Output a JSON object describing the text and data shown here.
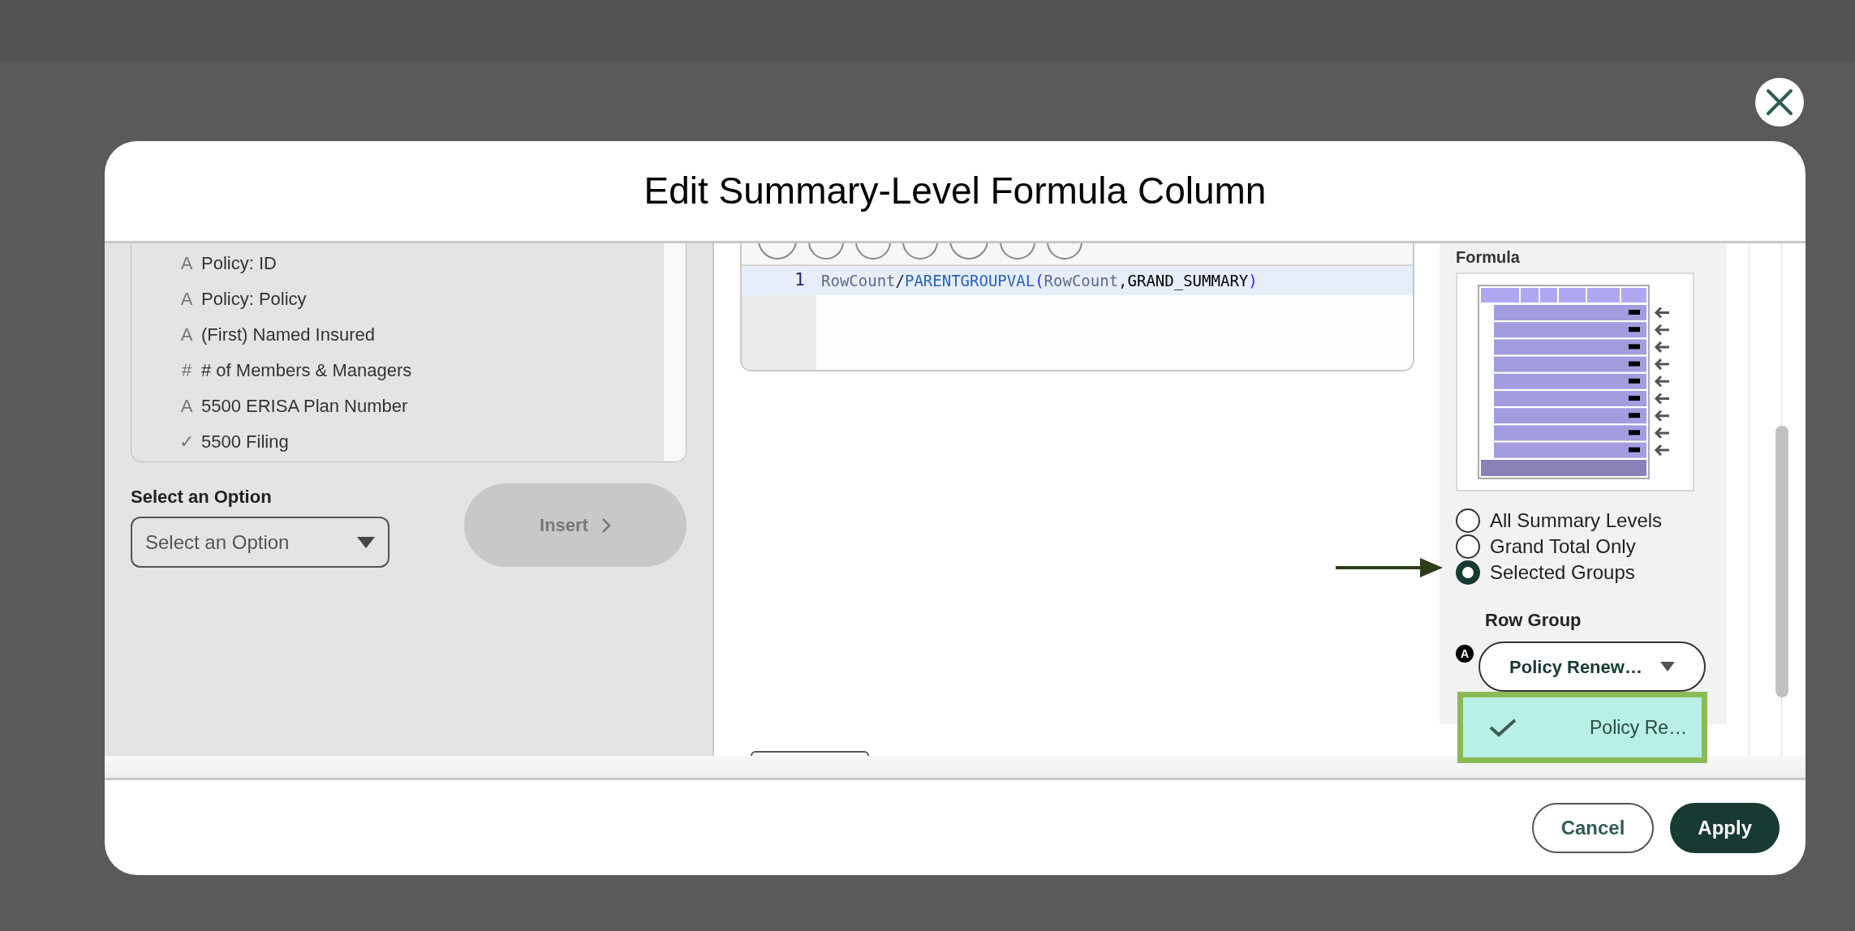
{
  "dialog": {
    "title": "Edit Summary-Level Formula Column"
  },
  "field_list": {
    "items": [
      {
        "icon": "A",
        "label": "Policy: ID"
      },
      {
        "icon": "A",
        "label": "Policy: Policy"
      },
      {
        "icon": "A",
        "label": "(First) Named Insured"
      },
      {
        "icon": "#",
        "label": "# of Members & Managers"
      },
      {
        "icon": "A",
        "label": "5500 ERISA Plan Number"
      },
      {
        "icon": "✓",
        "label": "5500 Filing"
      }
    ]
  },
  "option_select": {
    "label": "Select an Option",
    "placeholder": "Select an Option"
  },
  "insert_button": {
    "label": "Insert",
    "disabled": true
  },
  "editor": {
    "lines": [
      {
        "number": "1",
        "selected": true,
        "tokens": [
          {
            "text": "RowCount",
            "kind": "field"
          },
          {
            "text": "/",
            "kind": "operator"
          },
          {
            "text": "PARENTGROUPVAL",
            "kind": "function"
          },
          {
            "text": "(",
            "kind": "paren"
          },
          {
            "text": "RowCount",
            "kind": "field"
          },
          {
            "text": ",",
            "kind": "operator"
          },
          {
            "text": "GRAND_SUMMARY",
            "kind": "constant"
          },
          {
            "text": ")",
            "kind": "paren"
          }
        ]
      }
    ]
  },
  "display_options": {
    "label": "Formula",
    "radios": [
      {
        "label": "All Summary Levels",
        "selected": false
      },
      {
        "label": "Grand Total Only",
        "selected": false
      },
      {
        "label": "Selected Groups",
        "selected": true
      }
    ]
  },
  "row_group": {
    "label": "Row Group",
    "badge": "A",
    "value": "Policy Renew…",
    "menu": [
      {
        "label": "Policy Re…",
        "checked": true
      }
    ]
  },
  "buttons": [
    {
      "label": "Cancel",
      "kind": "secondary"
    },
    {
      "label": "Apply",
      "kind": "primary"
    }
  ]
}
